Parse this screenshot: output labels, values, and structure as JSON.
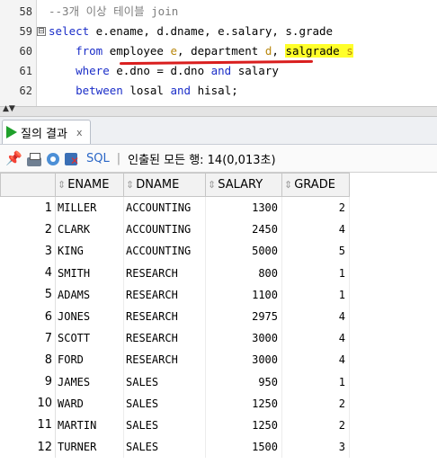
{
  "editor": {
    "lines": [
      {
        "num": "58",
        "parts": [
          {
            "t": "--3개 이상 테이블 join",
            "c": "cm"
          }
        ]
      },
      {
        "num": "59",
        "fold": "⊟",
        "parts": [
          {
            "t": "select",
            "c": "kw"
          },
          {
            "t": " e.ename, d.dname, e.salary, s.grade",
            "c": ""
          }
        ]
      },
      {
        "num": "60",
        "parts": [
          {
            "t": "    from",
            "c": "kw"
          },
          {
            "t": " employee ",
            "c": ""
          },
          {
            "t": "e",
            "c": "al"
          },
          {
            "t": ", department ",
            "c": ""
          },
          {
            "t": "d",
            "c": "al"
          },
          {
            "t": ", ",
            "c": ""
          },
          {
            "t": "salgrade ",
            "c": "hl"
          },
          {
            "t": "s",
            "c": "hl al"
          }
        ]
      },
      {
        "num": "61",
        "parts": [
          {
            "t": "    where",
            "c": "kw"
          },
          {
            "t": " e.dno = d.dno ",
            "c": ""
          },
          {
            "t": "and",
            "c": "kw"
          },
          {
            "t": " salary",
            "c": ""
          }
        ]
      },
      {
        "num": "62",
        "parts": [
          {
            "t": "    between",
            "c": "kw"
          },
          {
            "t": " losal ",
            "c": ""
          },
          {
            "t": "and",
            "c": "kw"
          },
          {
            "t": " hisal;",
            "c": ""
          }
        ]
      }
    ]
  },
  "splitter": {
    "arrows": "▲▼"
  },
  "result_tab": {
    "label": "질의 결과",
    "close": "x"
  },
  "toolbar": {
    "sql_label": "SQL",
    "separator": "|",
    "fetched_text": "인출된 모든 행: 14(0,013초)"
  },
  "grid": {
    "columns": [
      "ENAME",
      "DNAME",
      "SALARY",
      "GRADE"
    ],
    "sort_glyph": "⇕",
    "rows": [
      [
        "1",
        "MILLER",
        "ACCOUNTING",
        "1300",
        "2"
      ],
      [
        "2",
        "CLARK",
        "ACCOUNTING",
        "2450",
        "4"
      ],
      [
        "3",
        "KING",
        "ACCOUNTING",
        "5000",
        "5"
      ],
      [
        "4",
        "SMITH",
        "RESEARCH",
        "800",
        "1"
      ],
      [
        "5",
        "ADAMS",
        "RESEARCH",
        "1100",
        "1"
      ],
      [
        "6",
        "JONES",
        "RESEARCH",
        "2975",
        "4"
      ],
      [
        "7",
        "SCOTT",
        "RESEARCH",
        "3000",
        "4"
      ],
      [
        "8",
        "FORD",
        "RESEARCH",
        "3000",
        "4"
      ],
      [
        "9",
        "JAMES",
        "SALES",
        "950",
        "1"
      ],
      [
        "10",
        "WARD",
        "SALES",
        "1250",
        "2"
      ],
      [
        "11",
        "MARTIN",
        "SALES",
        "1250",
        "2"
      ],
      [
        "12",
        "TURNER",
        "SALES",
        "1500",
        "3"
      ]
    ]
  },
  "colors": {
    "keyword": "#1a2dc8",
    "comment": "#7d7d7d",
    "alias": "#b8860b",
    "highlight": "#ffff2a",
    "underline": "#d91e1e",
    "play": "#1fa02b"
  }
}
